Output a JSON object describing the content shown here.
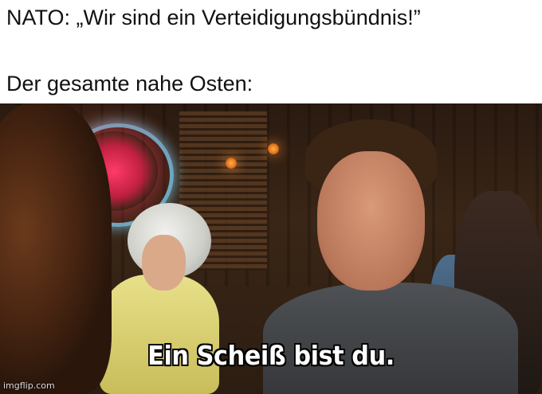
{
  "top_caption": "NATO: „Wir sind ein Verteidigungsbündnis!”",
  "second_caption": "Der gesamte nahe Osten:",
  "image_overlay_text": "Ein Scheiß bist du.",
  "watermark": "imgflip.com"
}
